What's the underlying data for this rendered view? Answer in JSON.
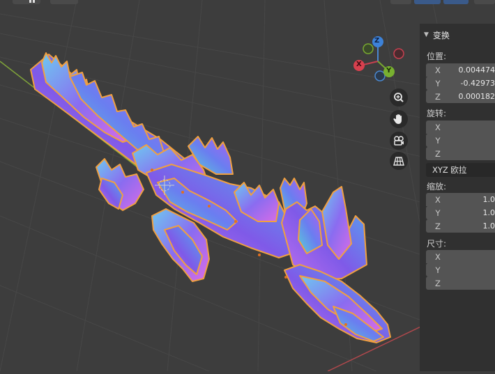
{
  "viewport": {
    "gizmo": {
      "z_label": "Z",
      "x_label": "X",
      "y_label": "Y"
    },
    "nav_buttons": [
      "zoom-icon",
      "hand-icon",
      "camera-icon",
      "grid-icon"
    ],
    "colors": {
      "background": "#3d3d3d",
      "grid": "#4a4a4a",
      "selection_outline": "#f0a040"
    }
  },
  "panel": {
    "title": "变换",
    "location": {
      "label": "位置:",
      "rows": [
        {
          "axis": "X",
          "value": "0.004474"
        },
        {
          "axis": "Y",
          "value": "-0.42973"
        },
        {
          "axis": "Z",
          "value": "0.000182"
        }
      ]
    },
    "rotation": {
      "label": "旋转:",
      "rows": [
        {
          "axis": "X",
          "value": ""
        },
        {
          "axis": "Y",
          "value": ""
        },
        {
          "axis": "Z",
          "value": ""
        }
      ],
      "mode": "XYZ 欧拉"
    },
    "scale": {
      "label": "缩放:",
      "rows": [
        {
          "axis": "X",
          "value": "1.0"
        },
        {
          "axis": "Y",
          "value": "1.0"
        },
        {
          "axis": "Z",
          "value": "1.0"
        }
      ]
    },
    "dimensions": {
      "label": "尺寸:",
      "rows": [
        {
          "axis": "X",
          "value": ""
        },
        {
          "axis": "Y",
          "value": ""
        },
        {
          "axis": "Z",
          "value": ""
        }
      ]
    }
  }
}
